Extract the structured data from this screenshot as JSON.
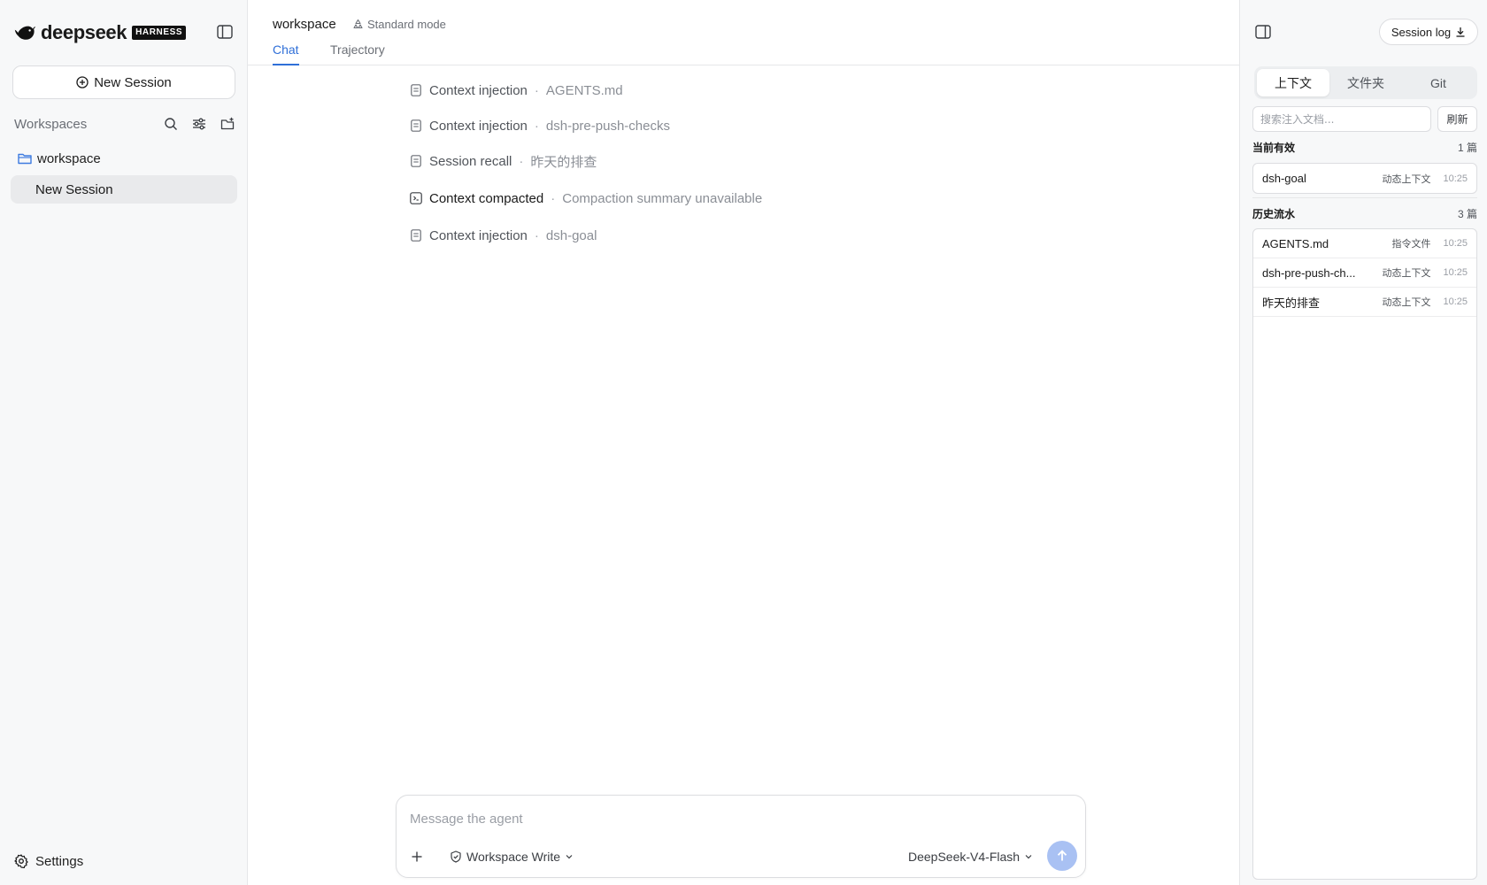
{
  "sidebar": {
    "brand_name": "deepseek",
    "brand_badge": "HARNESS",
    "new_session_label": "New Session",
    "workspaces_label": "Workspaces",
    "workspace_name": "workspace",
    "session_name": "New Session",
    "settings_label": "Settings"
  },
  "header": {
    "title": "workspace",
    "mode": "Standard mode",
    "tabs": [
      {
        "label": "Chat",
        "active": true
      },
      {
        "label": "Trajectory",
        "active": false
      }
    ]
  },
  "events": [
    {
      "icon": "document-icon",
      "title": "Context injection",
      "detail": "AGENTS.md"
    },
    {
      "icon": "document-icon",
      "title": "Context injection",
      "detail": "dsh-pre-push-checks"
    },
    {
      "icon": "document-icon",
      "title": "Session recall",
      "detail": "昨天的排查"
    },
    {
      "icon": "compact-icon",
      "title": "Context compacted",
      "detail": "Compaction summary unavailable"
    },
    {
      "icon": "document-icon",
      "title": "Context injection",
      "detail": "dsh-goal"
    }
  ],
  "composer": {
    "placeholder": "Message the agent",
    "permission_label": "Workspace Write",
    "model_label": "DeepSeek-V4-Flash"
  },
  "right_panel": {
    "session_log_label": "Session log",
    "tabs": [
      {
        "label": "上下文",
        "active": true
      },
      {
        "label": "文件夹",
        "active": false
      },
      {
        "label": "Git",
        "active": false
      }
    ],
    "search_placeholder": "搜索注入文档...",
    "refresh_label": "刷新",
    "current": {
      "title": "当前有效",
      "count": "1 篇",
      "items": [
        {
          "name": "dsh-goal",
          "kind": "动态上下文",
          "time": "10:25"
        }
      ]
    },
    "history": {
      "title": "历史流水",
      "count": "3 篇",
      "items": [
        {
          "name": "AGENTS.md",
          "kind": "指令文件",
          "time": "10:25"
        },
        {
          "name": "dsh-pre-push-ch...",
          "kind": "动态上下文",
          "time": "10:25"
        },
        {
          "name": "昨天的排查",
          "kind": "动态上下文",
          "time": "10:25"
        }
      ]
    }
  },
  "colors": {
    "accent": "#2f6fd8",
    "send_button": "#a9c1f3",
    "folder_icon": "#3d7be0"
  }
}
